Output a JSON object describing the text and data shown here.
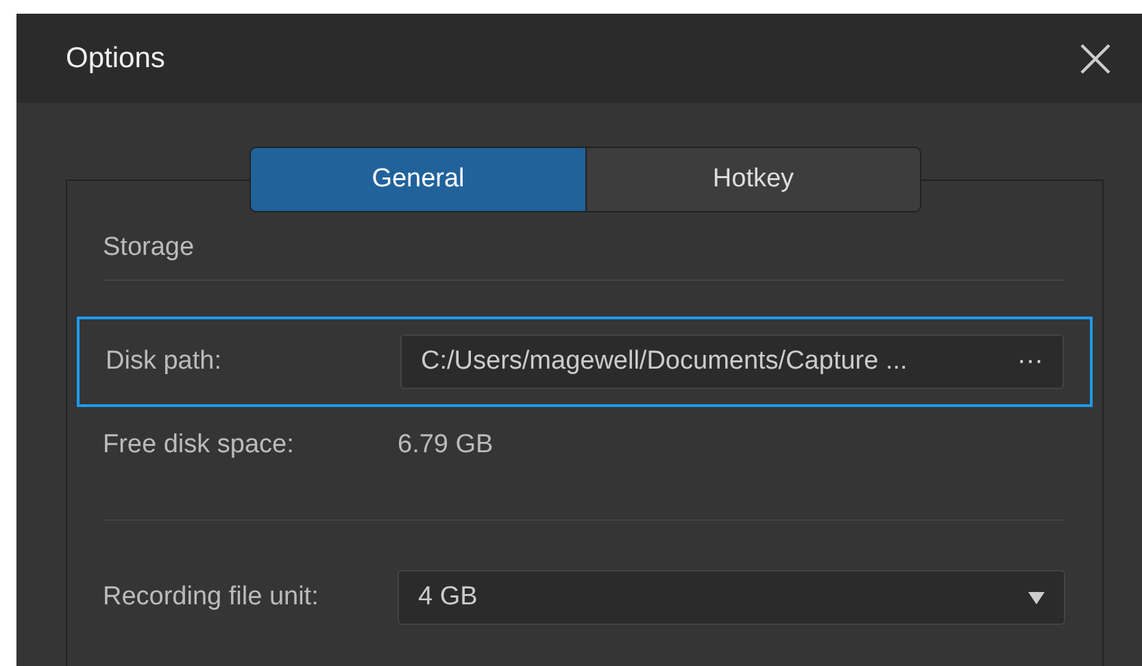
{
  "window": {
    "title": "Options"
  },
  "tabs": [
    {
      "label": "General",
      "selected": true
    },
    {
      "label": "Hotkey",
      "selected": false
    }
  ],
  "storage": {
    "heading": "Storage",
    "disk_path": {
      "label": "Disk path:",
      "value": "C:/Users/magewell/Documents/Capture ...",
      "browse": "···",
      "highlighted": true
    },
    "free_space": {
      "label": "Free disk space:",
      "value": "6.79 GB"
    },
    "recording_unit": {
      "label": "Recording file unit:",
      "value": "4 GB"
    }
  }
}
